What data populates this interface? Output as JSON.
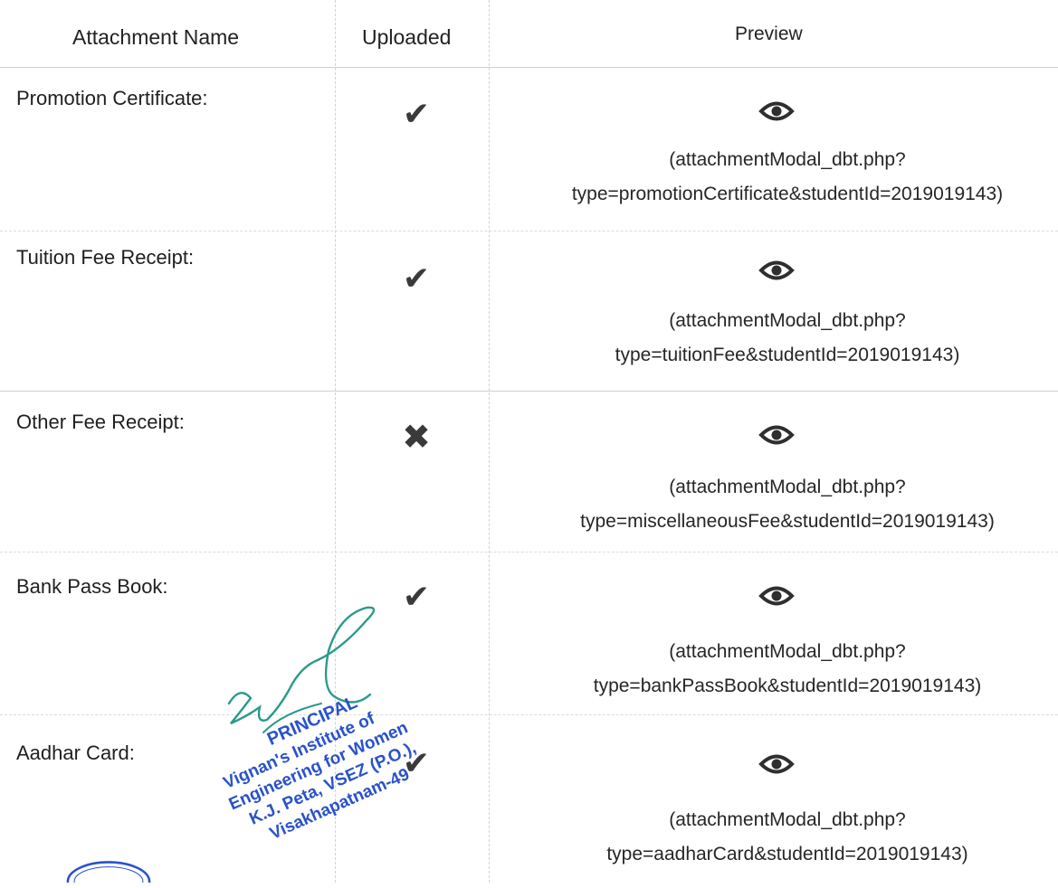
{
  "table": {
    "headers": {
      "name": "Attachment Name",
      "uploaded": "Uploaded",
      "preview": "Preview"
    },
    "rows": [
      {
        "name": "Promotion Certificate:",
        "status_icon": "check-icon",
        "preview_icon": "eye-icon",
        "link_line1": "(attachmentModal_dbt.php?",
        "link_line2": "type=promotionCertificate&studentId=2019019143)"
      },
      {
        "name": "Tuition Fee Receipt:",
        "status_icon": "check-icon",
        "preview_icon": "eye-icon",
        "link_line1": "(attachmentModal_dbt.php?",
        "link_line2": "type=tuitionFee&studentId=2019019143)"
      },
      {
        "name": "Other Fee Receipt:",
        "status_icon": "cross-icon",
        "preview_icon": "eye-icon",
        "link_line1": "(attachmentModal_dbt.php?",
        "link_line2": "type=miscellaneousFee&studentId=2019019143)"
      },
      {
        "name": "Bank Pass Book:",
        "status_icon": "check-icon",
        "preview_icon": "eye-icon",
        "link_line1": "(attachmentModal_dbt.php?",
        "link_line2": "type=bankPassBook&studentId=2019019143)"
      },
      {
        "name": "Aadhar Card:",
        "status_icon": "check-icon",
        "preview_icon": "eye-icon",
        "link_line1": "(attachmentModal_dbt.php?",
        "link_line2": "type=aadharCard&studentId=2019019143)"
      }
    ]
  },
  "stamp": {
    "line1": "PRINCIPAL",
    "line2": "Vignan's Institute of",
    "line3": "Engineering for Women",
    "line4": "K.J. Peta, VSEZ (P.O.),",
    "line5": "Visakhapatnam-49"
  },
  "colors": {
    "stamp_blue": "#2a52c9",
    "signature_green": "#2a9a8a",
    "icon_dark": "#3a3a3a"
  }
}
